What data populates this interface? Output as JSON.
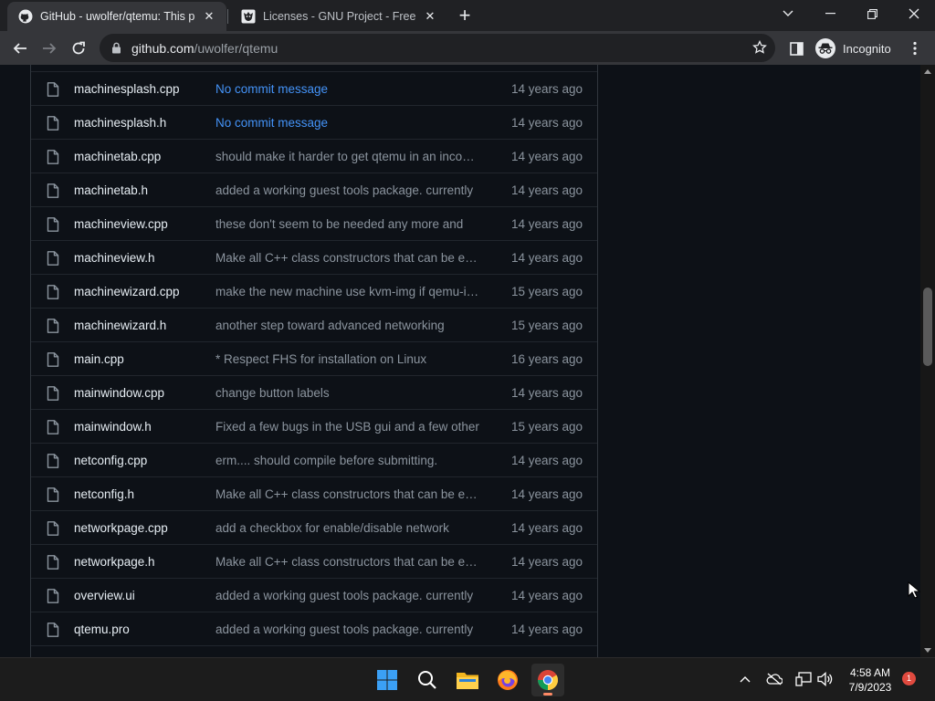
{
  "browser": {
    "tabs": [
      {
        "title": "GitHub - uwolfer/qtemu: This project",
        "favicon": "github-icon"
      },
      {
        "title": "Licenses - GNU Project - Free Software",
        "favicon": "gnu-icon"
      }
    ],
    "url": {
      "host": "github.com",
      "path": "/uwolfer/qtemu"
    },
    "profile_label": "Incognito"
  },
  "files": [
    {
      "name": "machinesplash.cpp",
      "message": "No commit message",
      "age": "14 years ago",
      "link": true
    },
    {
      "name": "machinesplash.h",
      "message": "No commit message",
      "age": "14 years ago",
      "link": true
    },
    {
      "name": "machinetab.cpp",
      "message": "should make it harder to get qtemu in an inconsistent state",
      "age": "14 years ago",
      "link": false
    },
    {
      "name": "machinetab.h",
      "message": "added a working guest tools package. currently",
      "age": "14 years ago",
      "link": false
    },
    {
      "name": "machineview.cpp",
      "message": "these don't seem to be needed any more and",
      "age": "14 years ago",
      "link": false
    },
    {
      "name": "machineview.h",
      "message": "Make all C++ class constructors that can be explicit",
      "age": "14 years ago",
      "link": false
    },
    {
      "name": "machinewizard.cpp",
      "message": "make the new machine use kvm-img if qemu-img",
      "age": "15 years ago",
      "link": false
    },
    {
      "name": "machinewizard.h",
      "message": "another step toward advanced networking",
      "age": "15 years ago",
      "link": false
    },
    {
      "name": "main.cpp",
      "message": "* Respect FHS for installation on Linux",
      "age": "16 years ago",
      "link": false
    },
    {
      "name": "mainwindow.cpp",
      "message": "change button labels",
      "age": "14 years ago",
      "link": false
    },
    {
      "name": "mainwindow.h",
      "message": "Fixed a few bugs in the USB gui and a few other",
      "age": "15 years ago",
      "link": false
    },
    {
      "name": "netconfig.cpp",
      "message": "erm.... should compile before submitting.",
      "age": "14 years ago",
      "link": false
    },
    {
      "name": "netconfig.h",
      "message": "Make all C++ class constructors that can be explicit",
      "age": "14 years ago",
      "link": false
    },
    {
      "name": "networkpage.cpp",
      "message": "add a checkbox for enable/disable network",
      "age": "14 years ago",
      "link": false
    },
    {
      "name": "networkpage.h",
      "message": "Make all C++ class constructors that can be explicit",
      "age": "14 years ago",
      "link": false
    },
    {
      "name": "overview.ui",
      "message": "added a working guest tools package. currently",
      "age": "14 years ago",
      "link": false
    },
    {
      "name": "qtemu.pro",
      "message": "added a working guest tools package. currently",
      "age": "14 years ago",
      "link": false
    }
  ],
  "taskbar": {
    "apps": [
      "start-icon",
      "search-icon",
      "file-explorer-icon",
      "firefox-icon",
      "chrome-icon"
    ],
    "time": "4:58 AM",
    "date": "7/9/2023",
    "notification_count": "1"
  }
}
